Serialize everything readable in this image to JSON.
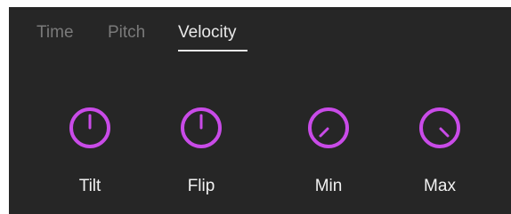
{
  "tabs": [
    {
      "label": "Time",
      "active": false
    },
    {
      "label": "Pitch",
      "active": false
    },
    {
      "label": "Velocity",
      "active": true
    }
  ],
  "knobs": [
    {
      "label": "Tilt",
      "level": 0.5
    },
    {
      "label": "Flip",
      "level": 0.5
    },
    {
      "label": "Min",
      "level": 0.125
    },
    {
      "label": "Max",
      "level": 0.875
    }
  ],
  "colors": {
    "panel_background": "#262626",
    "knob_accent": "#c94be8",
    "tab_active": "#e9e9e9",
    "tab_inactive": "#7a7a7a",
    "label_text": "#f2f2f2"
  }
}
